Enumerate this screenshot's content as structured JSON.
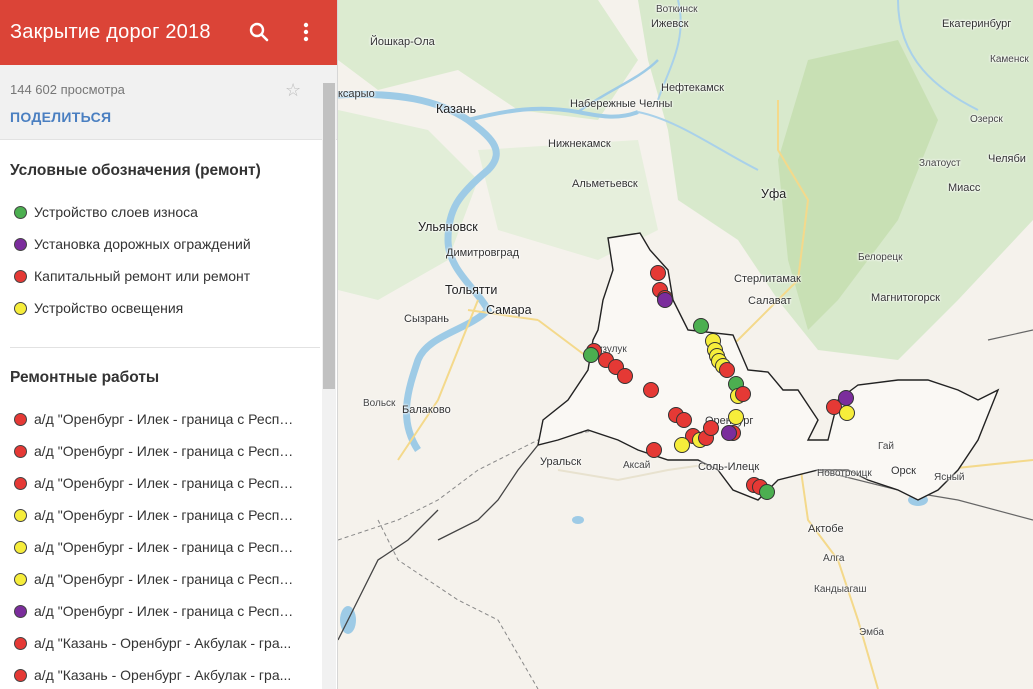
{
  "header": {
    "title": "Закрытие дорог 2018",
    "search_icon": "search-icon",
    "more_icon": "more-vert-icon"
  },
  "stats": {
    "views": "144 602 просмотра",
    "share_label": "ПОДЕЛИТЬСЯ",
    "star_icon": "star-icon"
  },
  "colors": {
    "green": "#4caf50",
    "purple": "#7b2d9c",
    "red": "#e53935",
    "yellow": "#f6ed3b",
    "accent": "#db4437"
  },
  "legend": {
    "title": "Условные обозначения (ремонт)",
    "items": [
      {
        "color": "green",
        "label": "Устройство слоев износа"
      },
      {
        "color": "purple",
        "label": "Установка дорожных ограждений"
      },
      {
        "color": "red",
        "label": "Капитальный ремонт или ремонт"
      },
      {
        "color": "yellow",
        "label": "Устройство освещения"
      }
    ]
  },
  "works": {
    "title": "Ремонтные работы",
    "items": [
      {
        "color": "red",
        "label": "а/д \"Оренбург - Илек - граница с Респу..."
      },
      {
        "color": "red",
        "label": "а/д \"Оренбург - Илек - граница с Респу..."
      },
      {
        "color": "red",
        "label": "а/д \"Оренбург - Илек - граница с Респу..."
      },
      {
        "color": "yellow",
        "label": "а/д \"Оренбург - Илек - граница с Респу..."
      },
      {
        "color": "yellow",
        "label": "а/д \"Оренбург - Илек - граница с Респу..."
      },
      {
        "color": "yellow",
        "label": "а/д \"Оренбург - Илек - граница с Респу..."
      },
      {
        "color": "purple",
        "label": "а/д \"Оренбург - Илек - граница с Респу..."
      },
      {
        "color": "red",
        "label": "а/д \"Казань - Оренбург - Акбулак - гра..."
      },
      {
        "color": "red",
        "label": "а/д \"Казань - Оренбург - Акбулак - гра..."
      }
    ]
  },
  "map": {
    "places": {
      "votkinsk": "Воткинск",
      "izhevsk": "Ижевск",
      "yekaterinburg": "Екатеринбург",
      "yoshkar_ola": "Йошкар-Ола",
      "kamensk": "Каменск",
      "samara_left": "ксарыо",
      "kazan": "Казань",
      "nab_chelny": "Набережные Челны",
      "neftekamsk": "Нефтекамск",
      "ozersk": "Озерск",
      "nizhnekamsk": "Нижнекамск",
      "zlatoust": "Златоуст",
      "chelyabinsk": "Челяби",
      "miass": "Миасс",
      "almetyevsk": "Альметьевск",
      "ufa": "Уфа",
      "ulyanovsk": "Ульяновск",
      "dimitrovgrad": "Димитровград",
      "sterlitamak": "Стерлитамак",
      "beloretsk": "Белорецк",
      "tolyatti": "Тольятти",
      "salavat": "Салават",
      "magnitogorsk": "Магнитогорск",
      "syzran": "Сызрань",
      "samara": "Самара",
      "buzuluk": "Бузулук",
      "volsk": "Вольск",
      "balakovo": "Балаково",
      "orenburg": "Оренбург",
      "gai": "Гай",
      "uralsk": "Уральск",
      "aksai": "Аксай",
      "sol_iletsk": "Соль-Илецк",
      "novotroitsk": "Новотроицк",
      "orsk": "Орск",
      "yasny": "Ясный",
      "aktobe": "Актобе",
      "alga": "Алга",
      "kandyagash": "Кандыагаш",
      "emba": "Эмба"
    },
    "markers": [
      "red",
      "red",
      "red",
      "purple",
      "red",
      "red",
      "red",
      "red",
      "green",
      "red",
      "green",
      "yellow",
      "yellow",
      "yellow",
      "yellow",
      "yellow",
      "red",
      "green",
      "yellow",
      "red",
      "red",
      "red",
      "red",
      "yellow",
      "red",
      "yellow",
      "red",
      "red",
      "purple",
      "yellow",
      "red",
      "red",
      "red",
      "green",
      "red",
      "purple",
      "yellow"
    ]
  }
}
